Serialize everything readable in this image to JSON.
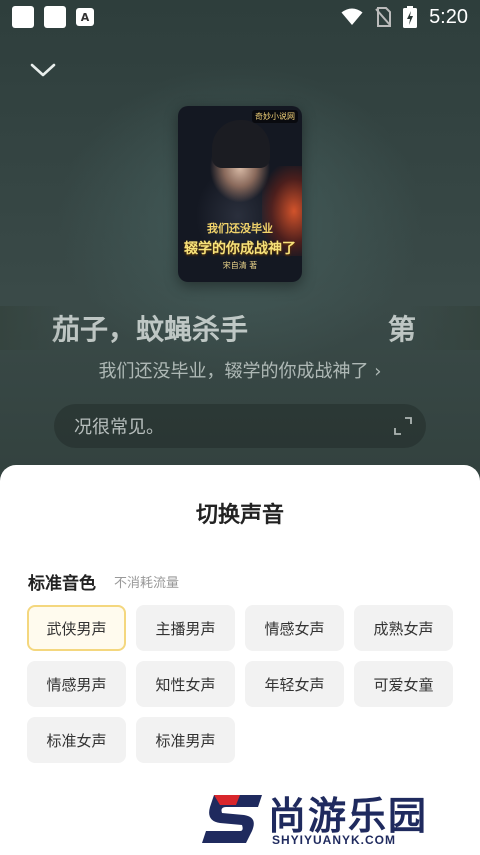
{
  "status_bar": {
    "time": "5:20",
    "app_icon_letter": "A"
  },
  "player": {
    "cover": {
      "badge": "奇妙小说网",
      "title_line1": "我们还没毕业",
      "title_line2": "辍学的你成战神了",
      "author": "宋自清 著"
    },
    "lyric_left": "茄子，蚊蝇杀手",
    "lyric_right": "第",
    "book_link": "我们还没毕业，辍学的你成战神了 ›",
    "text_preview": "况很常见。"
  },
  "sheet": {
    "title": "切换声音",
    "section_title": "标准音色",
    "section_subtitle": "不消耗流量",
    "voices": [
      {
        "label": "武侠男声",
        "selected": true
      },
      {
        "label": "主播男声",
        "selected": false
      },
      {
        "label": "情感女声",
        "selected": false
      },
      {
        "label": "成熟女声",
        "selected": false
      },
      {
        "label": "情感男声",
        "selected": false
      },
      {
        "label": "知性女声",
        "selected": false
      },
      {
        "label": "年轻女声",
        "selected": false
      },
      {
        "label": "可爱女童",
        "selected": false
      },
      {
        "label": "标准女声",
        "selected": false
      },
      {
        "label": "标准男声",
        "selected": false
      }
    ]
  },
  "watermark": {
    "brand": "尚游乐园",
    "url": "SHYIYUANYK.COM"
  },
  "colors": {
    "accent_border": "#f4d77e",
    "accent_bg": "#fffbee",
    "sheet_bg": "#ffffff"
  }
}
